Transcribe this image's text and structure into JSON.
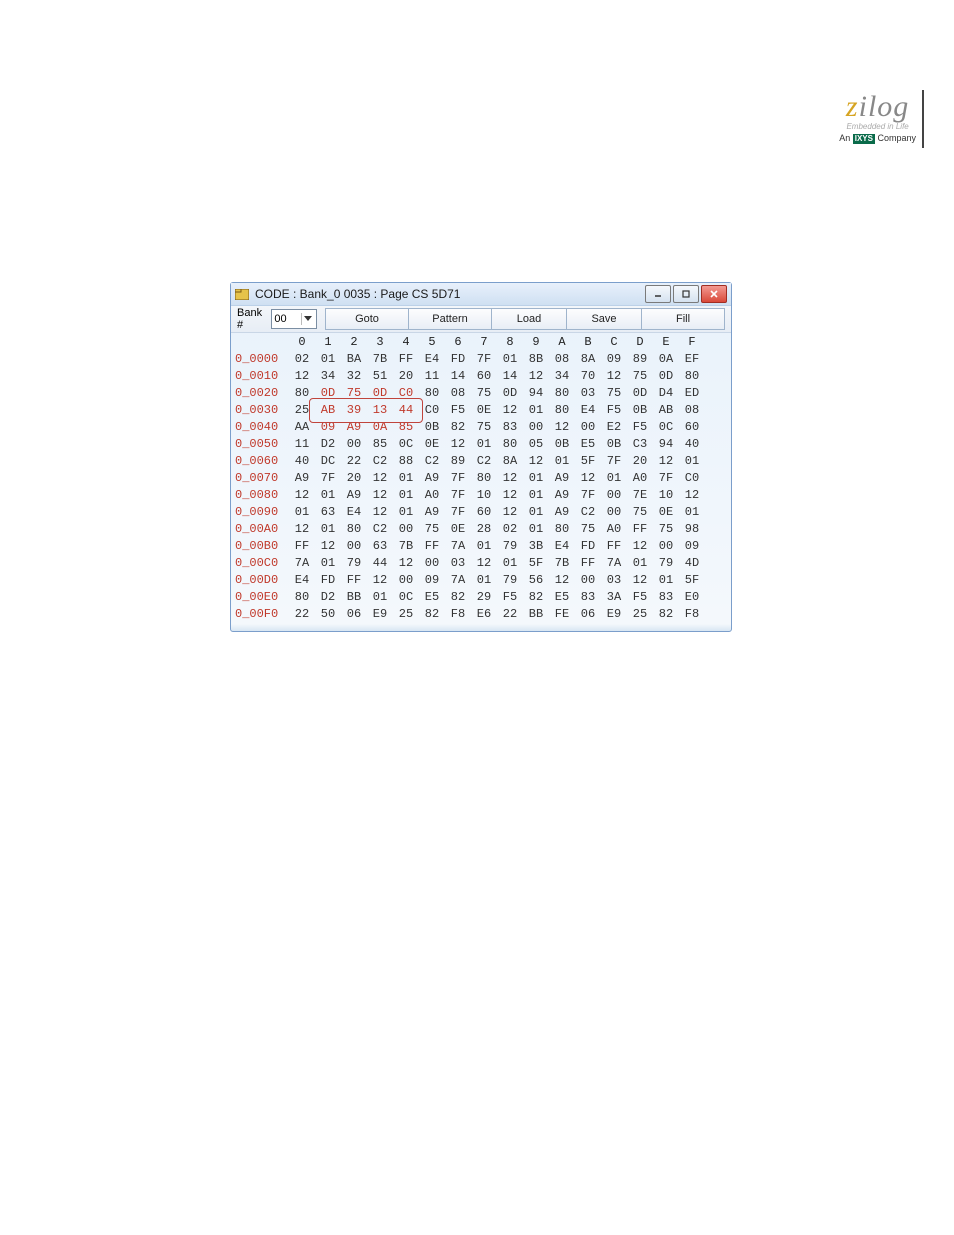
{
  "brand": {
    "name": "zilog",
    "tagline": "Embedded in Life",
    "company_prefix": "An ",
    "company_box": "IXYS",
    "company_suffix": " Company"
  },
  "window": {
    "title": "CODE : Bank_0 0035 : Page CS 5D71"
  },
  "toolbar": {
    "bank_label": "Bank #",
    "bank_value": "00",
    "goto": "Goto",
    "pattern": "Pattern",
    "load": "Load",
    "save": "Save",
    "fill": "Fill"
  },
  "columns": [
    "0",
    "1",
    "2",
    "3",
    "4",
    "5",
    "6",
    "7",
    "8",
    "9",
    "A",
    "B",
    "C",
    "D",
    "E",
    "F"
  ],
  "rows": [
    {
      "addr": "0_0000",
      "b": [
        "02",
        "01",
        "BA",
        "7B",
        "FF",
        "E4",
        "FD",
        "7F",
        "01",
        "8B",
        "08",
        "8A",
        "09",
        "89",
        "0A",
        "EF"
      ]
    },
    {
      "addr": "0_0010",
      "b": [
        "12",
        "34",
        "32",
        "51",
        "20",
        "11",
        "14",
        "60",
        "14",
        "12",
        "34",
        "70",
        "12",
        "75",
        "0D",
        "80"
      ]
    },
    {
      "addr": "0_0020",
      "b": [
        "80",
        "0D",
        "75",
        "0D",
        "C0",
        "80",
        "08",
        "75",
        "0D",
        "94",
        "80",
        "03",
        "75",
        "0D",
        "D4",
        "ED"
      ]
    },
    {
      "addr": "0_0030",
      "b": [
        "25",
        "AB",
        "39",
        "13",
        "44",
        "C0",
        "F5",
        "0E",
        "12",
        "01",
        "80",
        "E4",
        "F5",
        "0B",
        "AB",
        "08"
      ]
    },
    {
      "addr": "0_0040",
      "b": [
        "AA",
        "09",
        "A9",
        "0A",
        "85",
        "0B",
        "82",
        "75",
        "83",
        "00",
        "12",
        "00",
        "E2",
        "F5",
        "0C",
        "60"
      ]
    },
    {
      "addr": "0_0050",
      "b": [
        "11",
        "D2",
        "00",
        "85",
        "0C",
        "0E",
        "12",
        "01",
        "80",
        "05",
        "0B",
        "E5",
        "0B",
        "C3",
        "94",
        "40"
      ]
    },
    {
      "addr": "0_0060",
      "b": [
        "40",
        "DC",
        "22",
        "C2",
        "88",
        "C2",
        "89",
        "C2",
        "8A",
        "12",
        "01",
        "5F",
        "7F",
        "20",
        "12",
        "01"
      ]
    },
    {
      "addr": "0_0070",
      "b": [
        "A9",
        "7F",
        "20",
        "12",
        "01",
        "A9",
        "7F",
        "80",
        "12",
        "01",
        "A9",
        "12",
        "01",
        "A0",
        "7F",
        "C0"
      ]
    },
    {
      "addr": "0_0080",
      "b": [
        "12",
        "01",
        "A9",
        "12",
        "01",
        "A0",
        "7F",
        "10",
        "12",
        "01",
        "A9",
        "7F",
        "00",
        "7E",
        "10",
        "12"
      ]
    },
    {
      "addr": "0_0090",
      "b": [
        "01",
        "63",
        "E4",
        "12",
        "01",
        "A9",
        "7F",
        "60",
        "12",
        "01",
        "A9",
        "C2",
        "00",
        "75",
        "0E",
        "01"
      ]
    },
    {
      "addr": "0_00A0",
      "b": [
        "12",
        "01",
        "80",
        "C2",
        "00",
        "75",
        "0E",
        "28",
        "02",
        "01",
        "80",
        "75",
        "A0",
        "FF",
        "75",
        "98"
      ]
    },
    {
      "addr": "0_00B0",
      "b": [
        "FF",
        "12",
        "00",
        "63",
        "7B",
        "FF",
        "7A",
        "01",
        "79",
        "3B",
        "E4",
        "FD",
        "FF",
        "12",
        "00",
        "09"
      ]
    },
    {
      "addr": "0_00C0",
      "b": [
        "7A",
        "01",
        "79",
        "44",
        "12",
        "00",
        "03",
        "12",
        "01",
        "5F",
        "7B",
        "FF",
        "7A",
        "01",
        "79",
        "4D"
      ]
    },
    {
      "addr": "0_00D0",
      "b": [
        "E4",
        "FD",
        "FF",
        "12",
        "00",
        "09",
        "7A",
        "01",
        "79",
        "56",
        "12",
        "00",
        "03",
        "12",
        "01",
        "5F"
      ]
    },
    {
      "addr": "0_00E0",
      "b": [
        "80",
        "D2",
        "BB",
        "01",
        "0C",
        "E5",
        "82",
        "29",
        "F5",
        "82",
        "E5",
        "83",
        "3A",
        "F5",
        "83",
        "E0"
      ]
    },
    {
      "addr": "0_00F0",
      "b": [
        "22",
        "50",
        "06",
        "E9",
        "25",
        "82",
        "F8",
        "E6",
        "22",
        "BB",
        "FE",
        "06",
        "E9",
        "25",
        "82",
        "F8"
      ]
    }
  ],
  "highlights": [
    {
      "row": 2,
      "cols": [
        1,
        2,
        3,
        4
      ]
    },
    {
      "row": 3,
      "cols": [
        1,
        2,
        3,
        4
      ]
    },
    {
      "row": 4,
      "cols": [
        1,
        2,
        3,
        4
      ]
    }
  ]
}
